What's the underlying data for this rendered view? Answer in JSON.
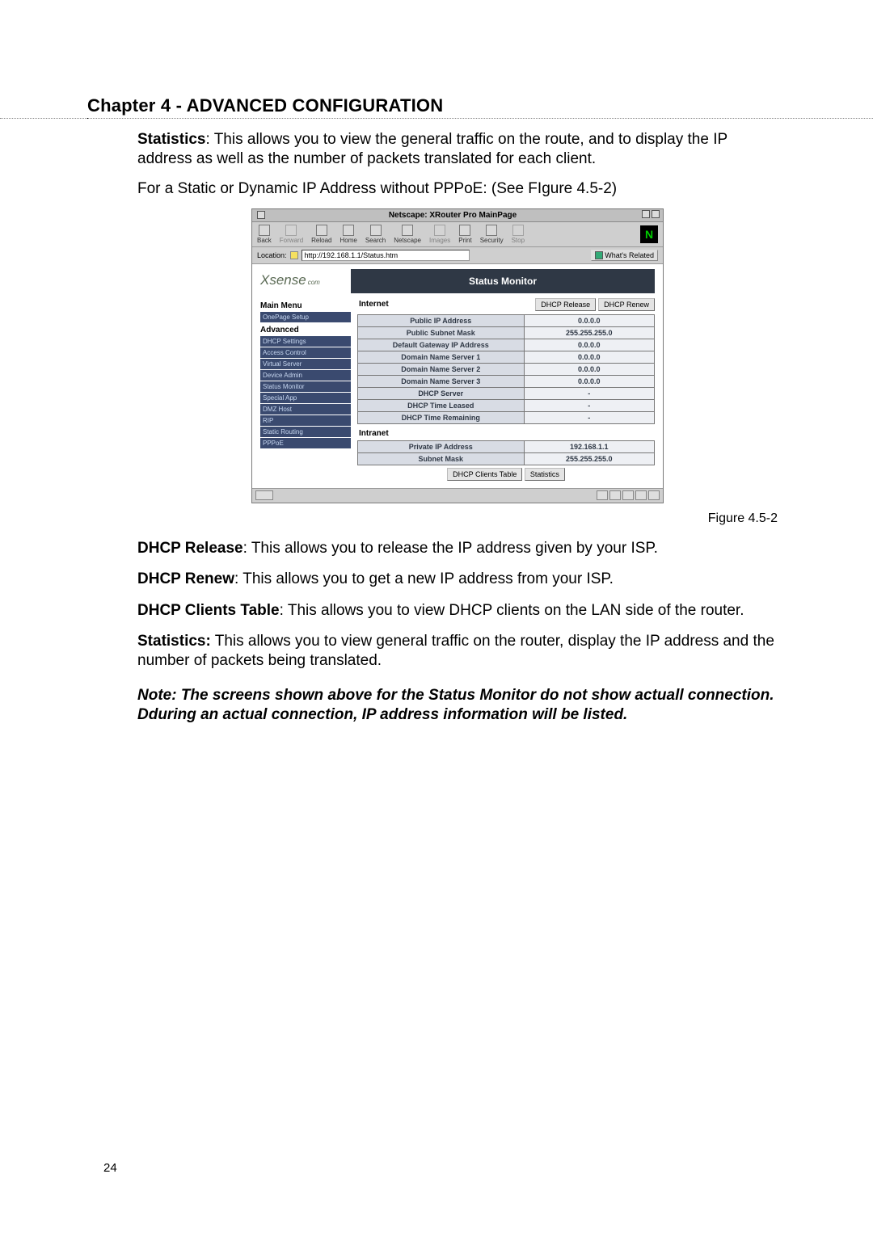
{
  "chapter_title": "Chapter 4 - ADVANCED CONFIGURATION",
  "para1_label": "Statistics",
  "para1_text": ":  This allows you to view the general traffic on the route, and to display the IP address as well as the number of packets translated for each client.",
  "para2": "For a Static or Dynamic IP Address without PPPoE:   (See FIgure 4.5-2)",
  "figure_caption": "Figure 4.5-2",
  "p_release_label": "DHCP Release",
  "p_release_text": ":  This allows you to release the IP address given by your ISP.",
  "p_renew_label": "DHCP Renew",
  "p_renew_text": ":  This allows you to get a new IP address from your ISP.",
  "p_clients_label": "DHCP Clients Table",
  "p_clients_text": ":  This allows you to view DHCP clients on the LAN side of the router.",
  "p_stats_label": "Statistics:",
  "p_stats_text": " This allows you to view general traffic on the router, display the IP address and the number of packets being translated.",
  "note": "Note: The screens shown above for the Status Monitor do not show actuall connection.  Dduring an actual connection, IP address information will be listed.",
  "page_number": "24",
  "ns": {
    "title": "Netscape: XRouter Pro MainPage",
    "toolbar": {
      "back": "Back",
      "forward": "Forward",
      "reload": "Reload",
      "home": "Home",
      "search": "Search",
      "netscape": "Netscape",
      "images": "Images",
      "print": "Print",
      "security": "Security",
      "stop": "Stop"
    },
    "location_label": "Location:",
    "location_value": "http://192.168.1.1/Status.htm",
    "related": "What's Related"
  },
  "router": {
    "logo": "Xsense",
    "logo_sub": "com",
    "banner": "Status Monitor",
    "menu_main": "Main Menu",
    "menu_onepage": "OnePage Setup",
    "menu_adv": "Advanced",
    "menu_items": [
      "DHCP Settings",
      "Access Control",
      "Virtual Server",
      "Device Admin",
      "Status Monitor",
      "Special App",
      "DMZ Host",
      "RIP",
      "Static Routing",
      "PPPoE"
    ],
    "btn_release": "DHCP Release",
    "btn_renew": "DHCP Renew",
    "internet_label": "Internet",
    "intranet_label": "Intranet",
    "btn_clients": "DHCP Clients Table",
    "btn_stats": "Statistics",
    "rows_internet": [
      {
        "k": "Public IP Address",
        "v": "0.0.0.0"
      },
      {
        "k": "Public Subnet Mask",
        "v": "255.255.255.0"
      },
      {
        "k": "Default Gateway IP Address",
        "v": "0.0.0.0"
      },
      {
        "k": "Domain Name Server 1",
        "v": "0.0.0.0"
      },
      {
        "k": "Domain Name Server 2",
        "v": "0.0.0.0"
      },
      {
        "k": "Domain Name Server 3",
        "v": "0.0.0.0"
      },
      {
        "k": "DHCP Server",
        "v": "-"
      },
      {
        "k": "DHCP Time Leased",
        "v": "-"
      },
      {
        "k": "DHCP Time Remaining",
        "v": "-"
      }
    ],
    "rows_intranet": [
      {
        "k": "Private IP Address",
        "v": "192.168.1.1"
      },
      {
        "k": "Subnet Mask",
        "v": "255.255.255.0"
      }
    ]
  }
}
